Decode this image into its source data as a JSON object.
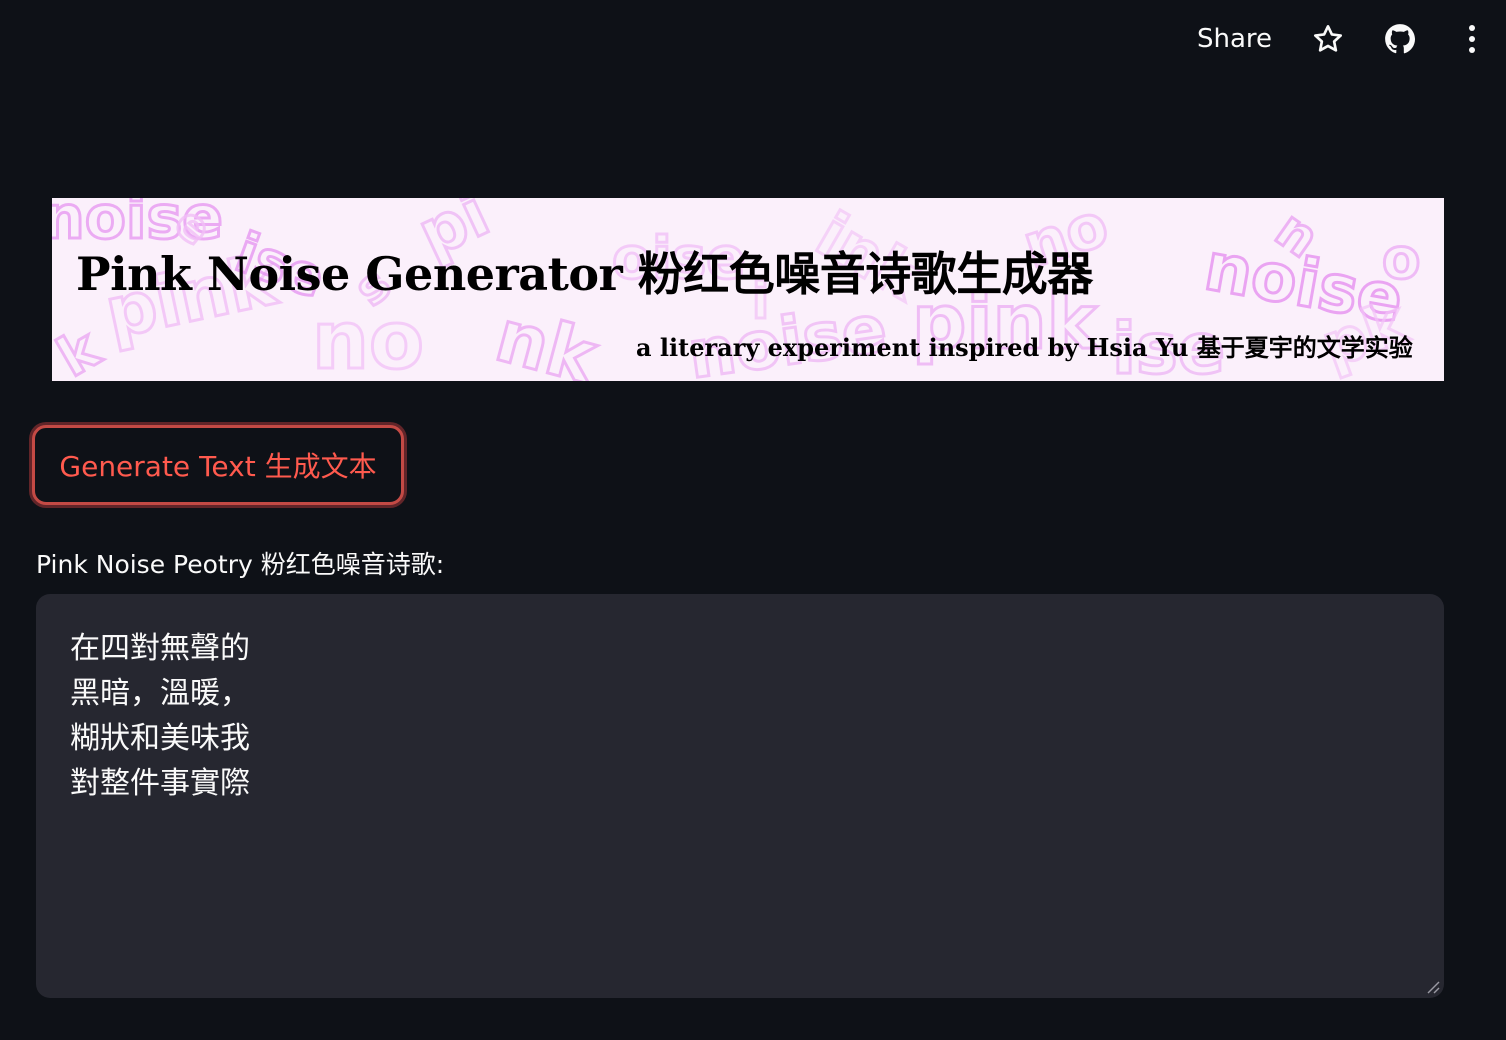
{
  "toolbar": {
    "share_label": "Share",
    "star_icon": "star-icon",
    "github_icon": "github-icon",
    "menu_icon": "more-vertical-icon"
  },
  "banner": {
    "title": "Pink Noise Generator 粉红色噪音诗歌生成器",
    "subtitle": "a literary experiment inspired by Hsia Yu 基于夏宇的文学实验",
    "accent_color": "#e08af0"
  },
  "generate_button": {
    "label": "Generate Text 生成文本",
    "color": "#ff5a4e"
  },
  "output": {
    "label": "Pink Noise Peotry 粉红色噪音诗歌:",
    "value": "在四對無聲的\n黑暗，溫暖，\n糊狀和美味我\n對整件事實際"
  },
  "colors": {
    "background": "#0e1117",
    "textarea_bg": "#262730",
    "text": "#fafafa"
  }
}
